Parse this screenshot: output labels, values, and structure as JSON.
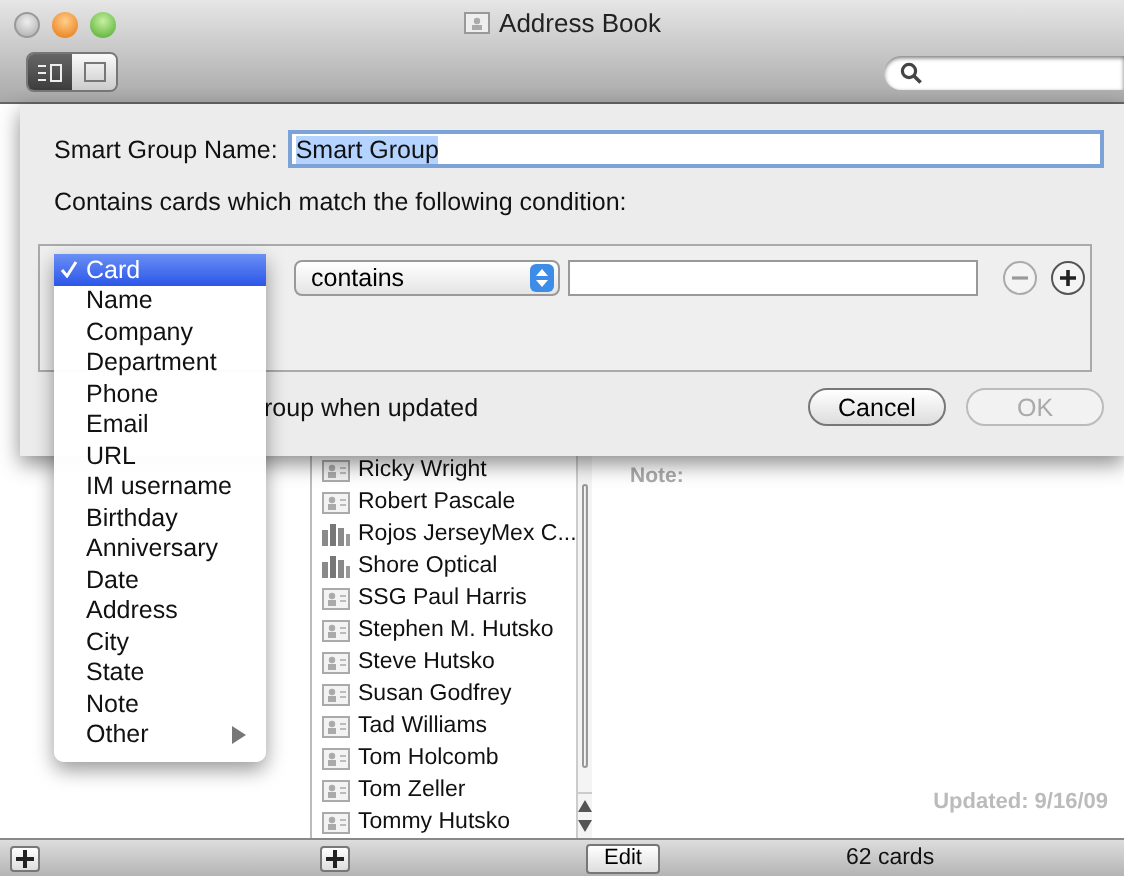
{
  "window": {
    "title": "Address Book"
  },
  "toolbar": {
    "view_buttons": [
      {
        "selected": true
      },
      {
        "selected": false
      }
    ]
  },
  "sheet": {
    "name_label": "Smart Group Name:",
    "name_value": "Smart Group",
    "condition_text": "Contains cards which match the following condition:",
    "field_menu": [
      {
        "label": "Card",
        "selected": true,
        "submenu": false
      },
      {
        "label": "Name",
        "selected": false,
        "submenu": false
      },
      {
        "label": "Company",
        "selected": false,
        "submenu": false
      },
      {
        "label": "Department",
        "selected": false,
        "submenu": false
      },
      {
        "label": "Phone",
        "selected": false,
        "submenu": false
      },
      {
        "label": "Email",
        "selected": false,
        "submenu": false
      },
      {
        "label": "URL",
        "selected": false,
        "submenu": false
      },
      {
        "label": "IM username",
        "selected": false,
        "submenu": false
      },
      {
        "label": "Birthday",
        "selected": false,
        "submenu": false
      },
      {
        "label": "Anniversary",
        "selected": false,
        "submenu": false
      },
      {
        "label": "Date",
        "selected": false,
        "submenu": false
      },
      {
        "label": "Address",
        "selected": false,
        "submenu": false
      },
      {
        "label": "City",
        "selected": false,
        "submenu": false
      },
      {
        "label": "State",
        "selected": false,
        "submenu": false
      },
      {
        "label": "Note",
        "selected": false,
        "submenu": false
      },
      {
        "label": "Other",
        "selected": false,
        "submenu": true
      }
    ],
    "operator": "contains",
    "checkbox_label": "roup when updated",
    "buttons": [
      {
        "label": "Cancel",
        "disabled": false
      },
      {
        "label": "OK",
        "disabled": true
      }
    ]
  },
  "names": [
    {
      "name": "Ricky Wright",
      "kind": "person"
    },
    {
      "name": "Robert Pascale",
      "kind": "person"
    },
    {
      "name": "Rojos JerseyMex C...",
      "kind": "company"
    },
    {
      "name": "Shore Optical",
      "kind": "company"
    },
    {
      "name": "SSG Paul Harris",
      "kind": "person"
    },
    {
      "name": "Stephen M. Hutsko",
      "kind": "person"
    },
    {
      "name": "Steve Hutsko",
      "kind": "person"
    },
    {
      "name": "Susan Godfrey",
      "kind": "person"
    },
    {
      "name": "Tad Williams",
      "kind": "person"
    },
    {
      "name": "Tom Holcomb",
      "kind": "person"
    },
    {
      "name": "Tom Zeller",
      "kind": "person"
    },
    {
      "name": "Tommy Hutsko",
      "kind": "person"
    }
  ],
  "card": {
    "note_label": "Note:",
    "updated": "Updated: 9/16/09"
  },
  "footer": {
    "edit": "Edit",
    "count": "62 cards"
  }
}
